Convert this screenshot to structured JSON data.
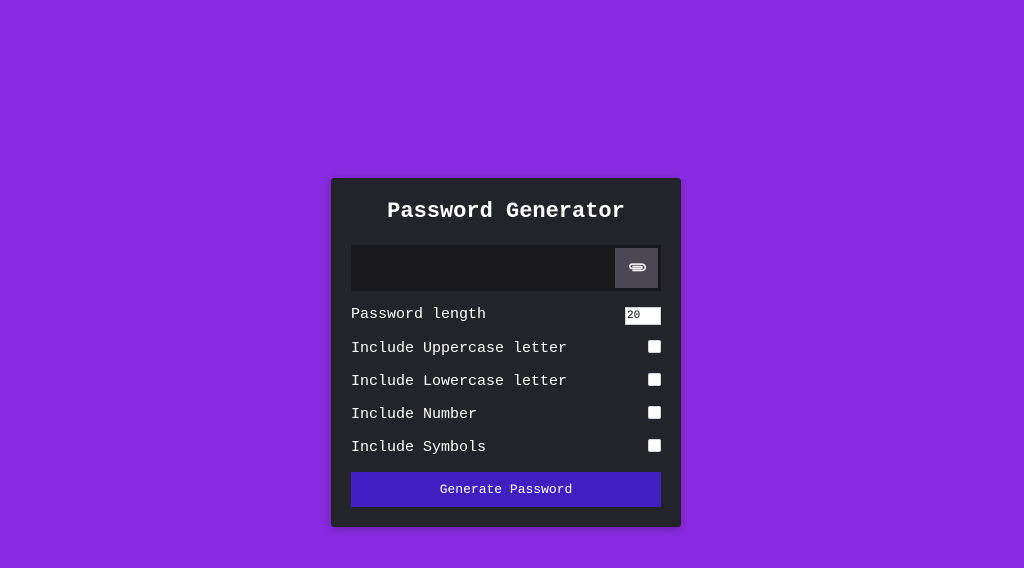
{
  "app": {
    "title": "Password Generator"
  },
  "result": {
    "value": "",
    "copy_icon": "paperclip-icon"
  },
  "settings": {
    "length_label": "Password length",
    "length_value": "20",
    "uppercase_label": "Include Uppercase letter",
    "uppercase_checked": false,
    "lowercase_label": "Include Lowercase letter",
    "lowercase_checked": false,
    "number_label": "Include Number",
    "number_checked": false,
    "symbols_label": "Include Symbols",
    "symbols_checked": false
  },
  "actions": {
    "generate_label": "Generate Password"
  },
  "colors": {
    "background": "#8a2be2",
    "card": "#23232a",
    "result_box": "#19191b",
    "clipboard_button": "#4b4753",
    "generate_button": "#3f1fbf",
    "text": "#ffffff"
  }
}
